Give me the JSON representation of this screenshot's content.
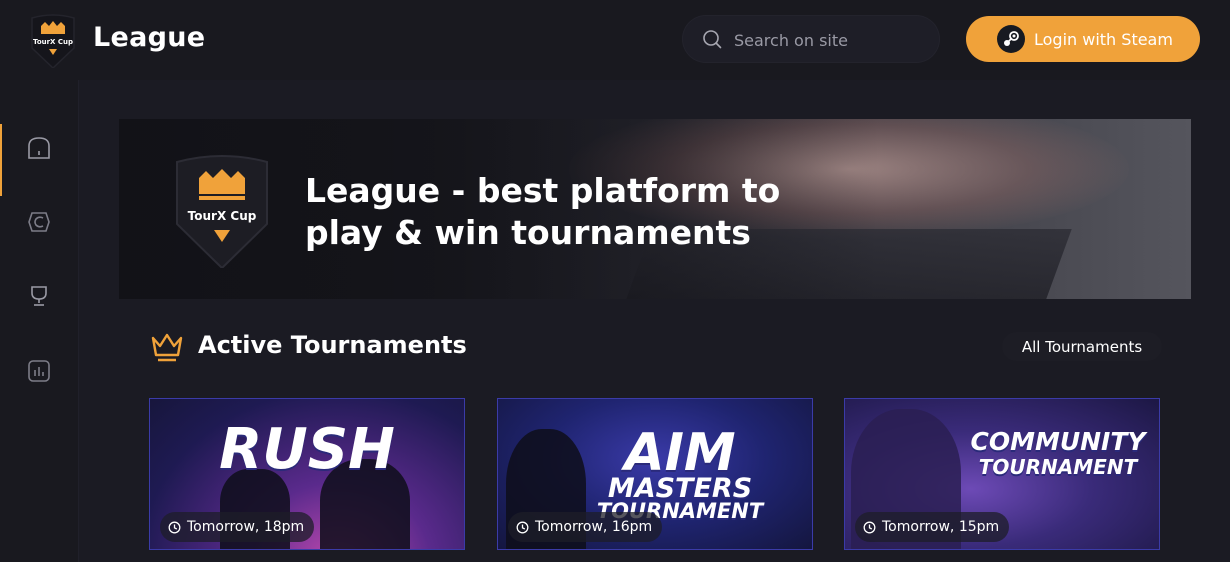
{
  "header": {
    "logo_text": "TourX Cup",
    "brand": "League",
    "search_placeholder": "Search on site",
    "login_label": "Login with Steam"
  },
  "sidebar": {
    "items": [
      {
        "name": "home-icon",
        "active": true
      },
      {
        "name": "game-icon",
        "active": false
      },
      {
        "name": "trophy-icon",
        "active": false
      },
      {
        "name": "stats-icon",
        "active": false
      }
    ]
  },
  "hero": {
    "logo_text": "TourX Cup",
    "title": "League - best platform to play & win tournaments"
  },
  "section": {
    "title": "Active Tournaments",
    "all_label": "All Tournaments"
  },
  "tournaments": [
    {
      "title": "RUSH",
      "time": "Tomorrow, 18pm"
    },
    {
      "title_line1": "AIM",
      "title_line2": "MASTERS",
      "title_line3": "TOURNAMENT",
      "time": "Tomorrow, 16pm"
    },
    {
      "title_line1": "COMMUNITY",
      "title_line2": "TOURNAMENT",
      "time": "Tomorrow, 15pm"
    }
  ],
  "colors": {
    "accent": "#f0a23a",
    "background": "#1b1b23",
    "header": "#19191f"
  }
}
